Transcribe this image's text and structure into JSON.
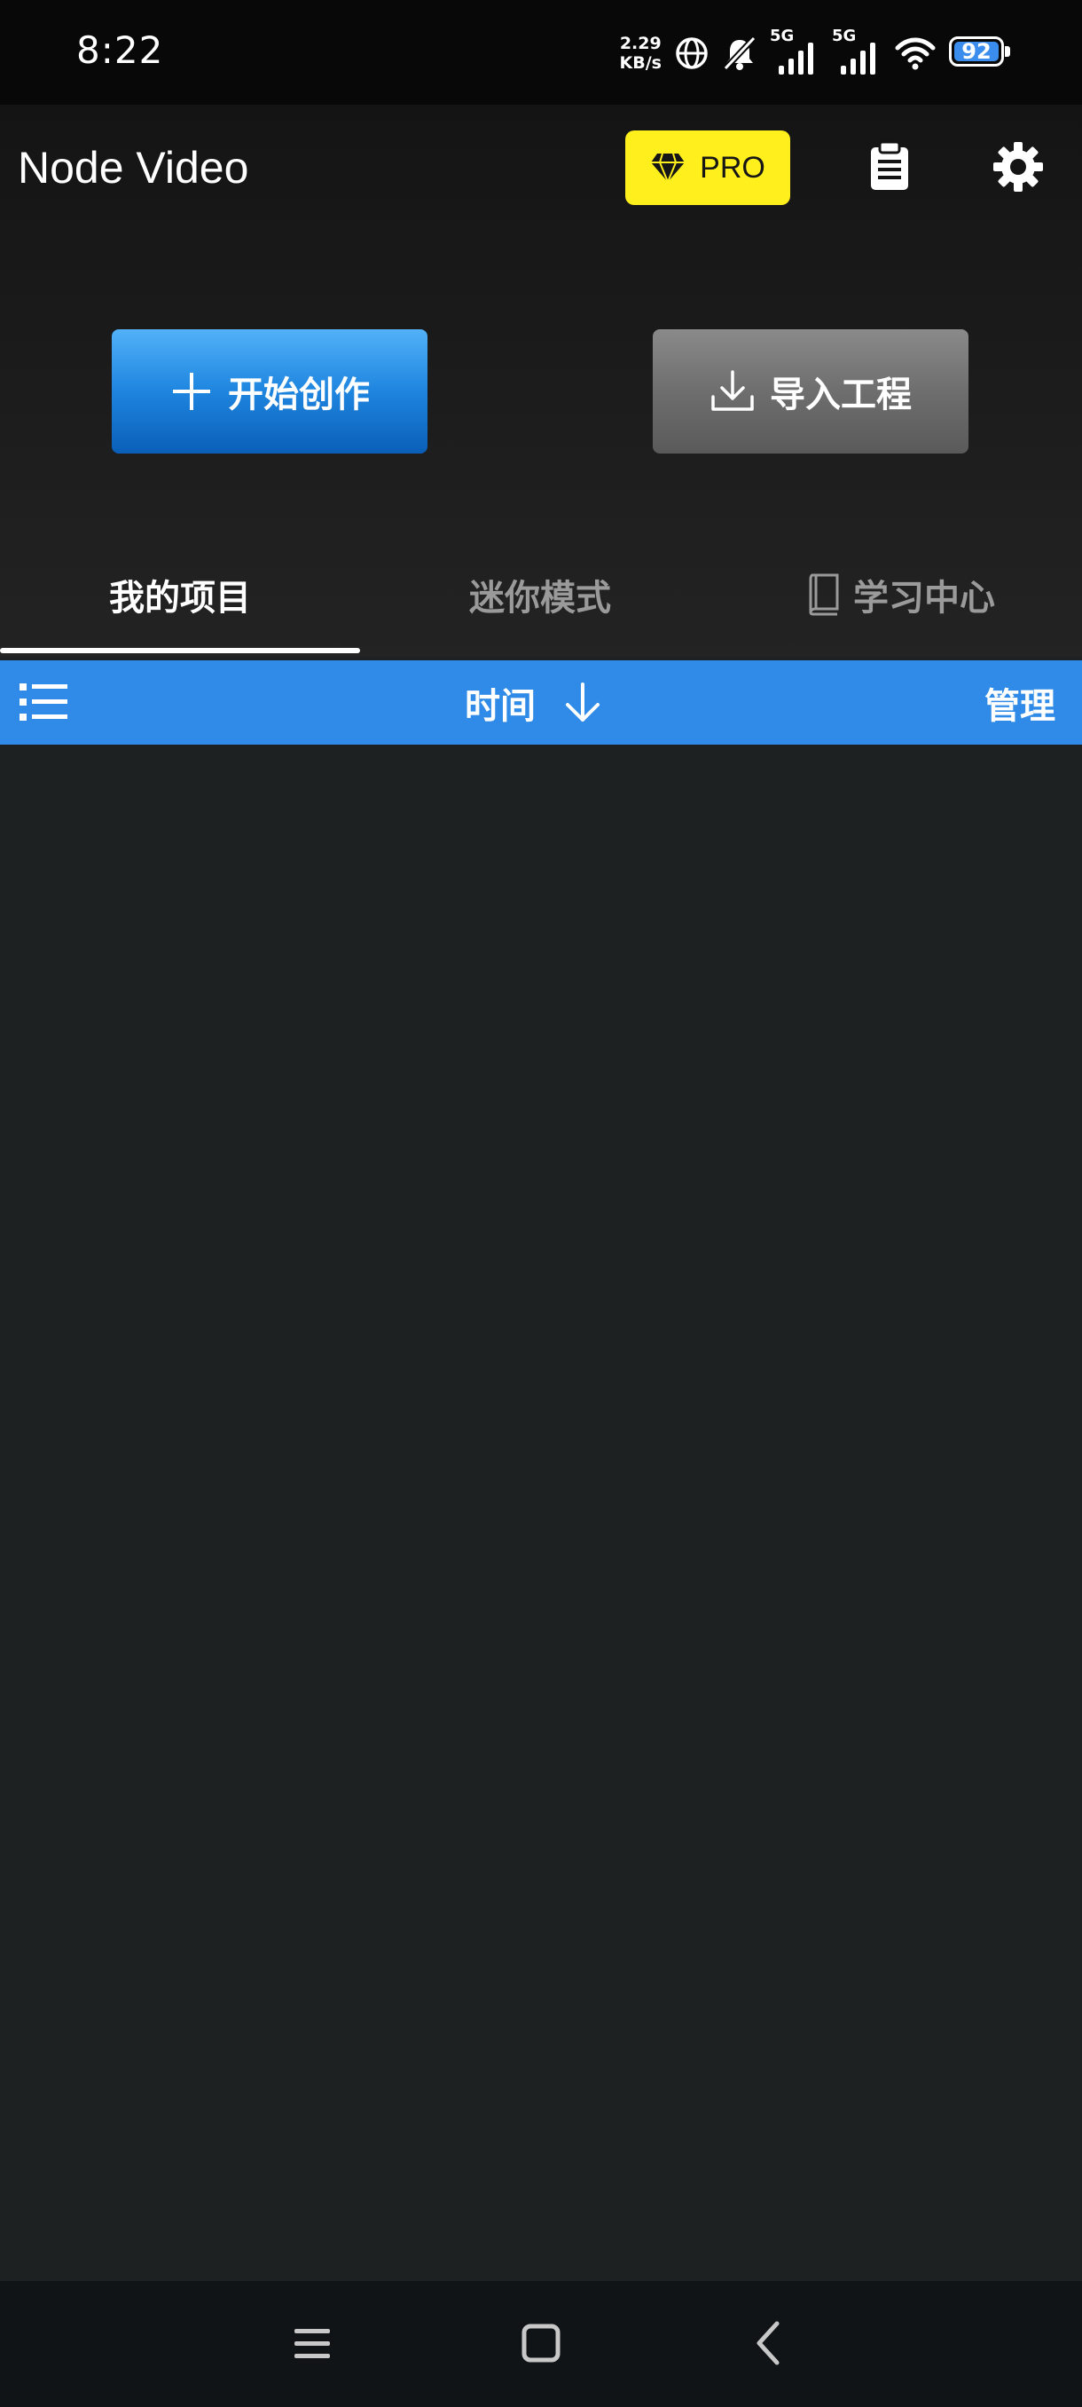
{
  "status_bar": {
    "time": "8:22",
    "net_speed_value": "2.29",
    "net_speed_unit": "KB/s",
    "sim1_tag": "5G",
    "sim2_tag": "5G",
    "battery": "92",
    "icons": [
      "globe-icon",
      "bell-off-icon",
      "signal-icon",
      "signal-icon",
      "wifi-icon",
      "battery-icon"
    ]
  },
  "header": {
    "app_title": "Node Video",
    "pro_label": "PRO",
    "colors": {
      "pro": "#ffef1c",
      "accent": "#2f8be7"
    }
  },
  "actions": {
    "create_label": "开始创作",
    "import_label": "导入工程"
  },
  "tabs": [
    {
      "label": "我的项目",
      "active": true
    },
    {
      "label": "迷你模式",
      "active": false
    },
    {
      "label": "学习中心",
      "active": false
    }
  ],
  "sort_bar": {
    "sort_label": "时间",
    "manage_label": "管理"
  }
}
